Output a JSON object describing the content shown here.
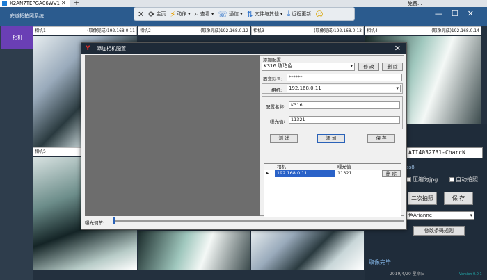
{
  "tab": {
    "title": "X2AN7TEPGA06WV1",
    "close": "✕",
    "plus": "+",
    "right_text": "免费..."
  },
  "app": {
    "title": "安道拓拍照系统",
    "win_controls": "—☐✕"
  },
  "toolbar": {
    "close": "✕",
    "home": "主页",
    "action": "动作",
    "view": "查看",
    "comm": "通信",
    "file": "文件与其他",
    "remote": "远程更新",
    "emoji": "☺"
  },
  "sidebar": {
    "camera": "相机"
  },
  "cams": [
    {
      "name": "相机1",
      "status": "(取像完成)",
      "ip": "192.168.0.11"
    },
    {
      "name": "相机2",
      "status": "(取像完成)",
      "ip": "192.168.0.12"
    },
    {
      "name": "相机3",
      "status": "(取像完成)",
      "ip": "192.168.0.13"
    },
    {
      "name": "相机4",
      "status": "(取像完成)",
      "ip": "192.168.0.14"
    },
    {
      "name": "相机5"
    }
  ],
  "right": {
    "code": "ATI4032731-CharcN",
    "label_jpg": "压缩为jpg",
    "label_auto": "自动拍照",
    "btn_second": "二次拍照",
    "btn_save": "保 存",
    "select": "色Arianne",
    "btn_barcode": "修改条码规则",
    "fragment": "ss8",
    "status": "取像完毕",
    "date": "2019/4/20 星期日",
    "version": "Version 0.0.1"
  },
  "dialog": {
    "title": "添加相机配置",
    "add_header": "添加配置",
    "config_select": "K316 玻珀色",
    "btn_modify": "修 改",
    "btn_delete": "删 除",
    "label_face": "面套料号:",
    "face_value": "******",
    "label_camera": "相机:",
    "camera_value": "192.168.0.11",
    "label_cfgname": "配置名称:",
    "cfgname_value": "K316",
    "label_exposure": "曝光值:",
    "exposure_value": "11321",
    "btn_test": "测 试",
    "btn_add": "添 加",
    "btn_save": "保 存",
    "grid_headers": [
      "相机",
      "曝光值"
    ],
    "grid_row": {
      "camera": "192.168.0.11",
      "exposure": "11321",
      "action": "删 除"
    },
    "exposure_label": "曝光调节:"
  }
}
